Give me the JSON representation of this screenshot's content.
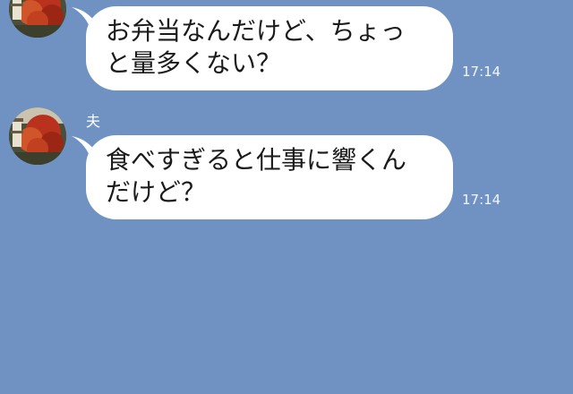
{
  "colors": {
    "background": "#7092c3",
    "bubble": "#ffffff",
    "text": "#1a1a1a",
    "meta_text": "#ffffff"
  },
  "messages": [
    {
      "sender": "",
      "lines": [
        "お弁当なんだけど、ちょっ",
        "と量多くない？"
      ],
      "time": "17:14",
      "avatar_icon": "autumn-tree-avatar-icon"
    },
    {
      "sender": "夫",
      "lines": [
        "食べすぎると仕事に響くん",
        "だけど？"
      ],
      "time": "17:14",
      "avatar_icon": "autumn-tree-avatar-icon"
    }
  ]
}
